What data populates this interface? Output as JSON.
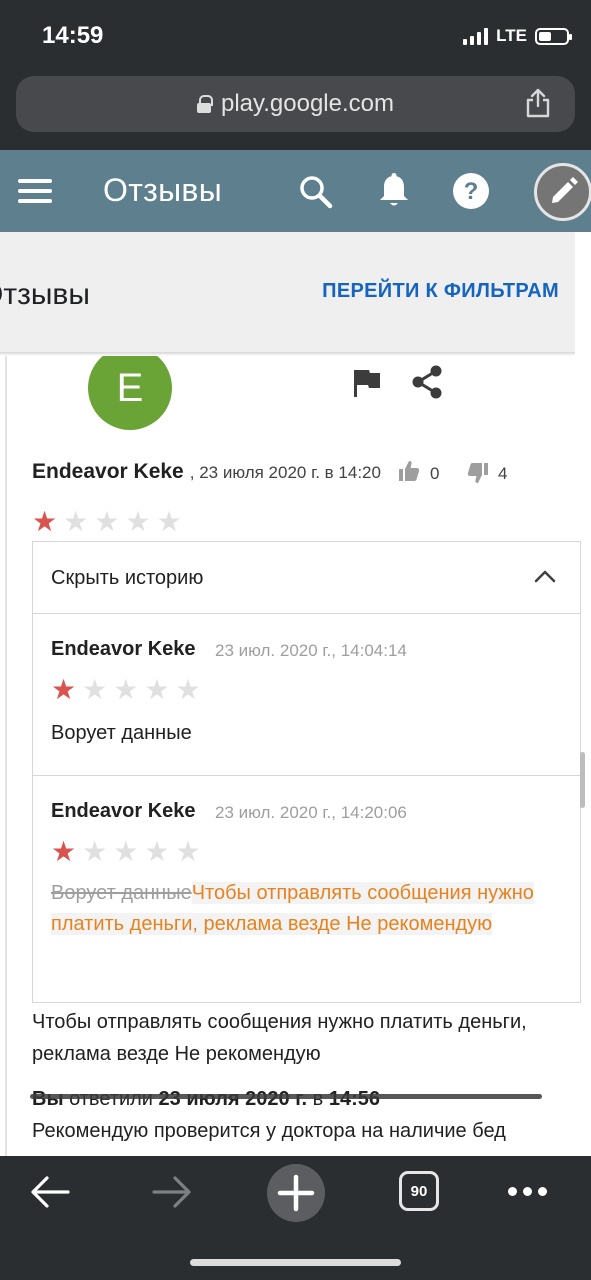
{
  "status_bar": {
    "time": "14:59",
    "network": "LTE"
  },
  "browser": {
    "url": "play.google.com",
    "tab_count": "90"
  },
  "app_bar": {
    "title": "Отзывы"
  },
  "sub_header": {
    "title": "Отзывы",
    "filters_link": "ПЕРЕЙТИ К ФИЛЬТРАМ"
  },
  "review": {
    "avatar_letter": "E",
    "author": "Endeavor Keke",
    "date": ", 23 июля 2020 г. в 14:20",
    "thumbs_up": "0",
    "thumbs_down": "4",
    "rating": 1,
    "text": "Чтобы отправлять сообщения нужно платить деньги, реклама везде Не рекомендую"
  },
  "history": {
    "toggle_label": "Скрыть историю",
    "entries": [
      {
        "author": "Endeavor Keke",
        "date": "23 июл. 2020 г., 14:04:14",
        "rating": 1,
        "text": "Ворует данные"
      },
      {
        "author": "Endeavor Keke",
        "date": "23 июл. 2020 г., 14:20:06",
        "rating": 1,
        "removed_text": "Ворует данные",
        "added_text": "Чтобы отправлять сообщения нужно платить деньги, реклама везде Не рекомендую"
      }
    ]
  },
  "reply": {
    "you": "Вы",
    "replied": " ответили ",
    "date": "23 июля 2020 г.",
    "at": " в ",
    "time": "14:56",
    "text": "Рекомендую проверится у доктора на наличие бед"
  },
  "colors": {
    "app_bar": "#5e7f8d",
    "link": "#1565c0",
    "star_on": "#d9534f",
    "added_text": "#e8821e",
    "avatar": "#6aa436"
  }
}
